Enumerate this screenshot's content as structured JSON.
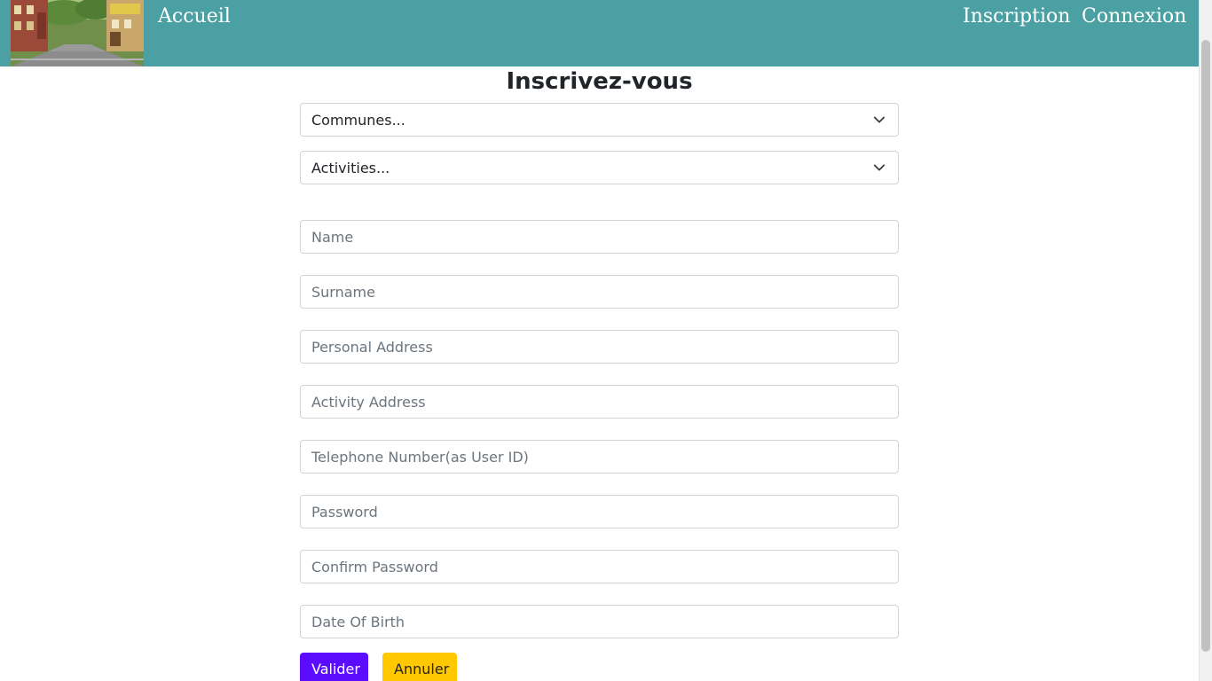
{
  "nav": {
    "home_label": "Accueil",
    "register_label": "Inscription",
    "login_label": "Connexion"
  },
  "form": {
    "title": "Inscrivez-vous",
    "communes_select": "Communes...",
    "activities_select": "Activities...",
    "name_placeholder": "Name",
    "surname_placeholder": "Surname",
    "personal_address_placeholder": "Personal Address",
    "activity_address_placeholder": "Activity Address",
    "telephone_placeholder": "Telephone Number(as User ID)",
    "password_placeholder": "Password",
    "confirm_password_placeholder": "Confirm Password",
    "dob_placeholder": "Date Of Birth",
    "submit_label": "Valider",
    "cancel_label": "Annuler"
  },
  "colors": {
    "navbar": "#4aa0a2",
    "submit": "#5b0cff",
    "cancel": "#ffc800"
  }
}
